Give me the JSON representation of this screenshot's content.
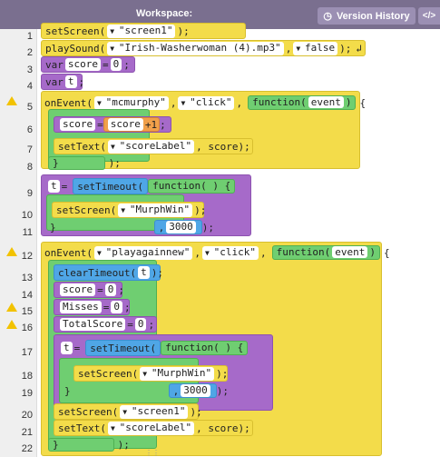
{
  "header": {
    "title": "Workspace:",
    "version_history": "Version History",
    "code_toggle": "</>"
  },
  "line_numbers": [
    "1",
    "2",
    "3",
    "4",
    "5",
    "6",
    "7",
    "8",
    "9",
    "10",
    "11",
    "12",
    "13",
    "14",
    "15",
    "16",
    "17",
    "18",
    "19",
    "20",
    "21",
    "22"
  ],
  "warnings_on_lines": [
    5,
    12,
    15,
    16
  ],
  "code": {
    "l1": {
      "fn": "setScreen(",
      "arg": "\"screen1\"",
      "end": ");"
    },
    "l2": {
      "fn": "playSound(",
      "arg1": "\"Irish-Washerwoman (4).mp3\"",
      "comma": ",",
      "arg2": "false",
      "end": ");"
    },
    "l3": {
      "kw": "var",
      "name": "score",
      "eq": "=",
      "val": "0",
      "end": ";"
    },
    "l4": {
      "kw": "var",
      "name": "t",
      "end": ";"
    },
    "l5": {
      "fn": "onEvent(",
      "arg1": "\"mcmurphy\"",
      "comma": ",",
      "arg2": "\"click\"",
      "comma2": ",",
      "func": "function(",
      "param": "event",
      "close": ")",
      "brace": "{"
    },
    "l6": {
      "lhs": "score",
      "eq": "=",
      "rhs": "score",
      "op": "+",
      "num": "1",
      "end": ";"
    },
    "l7": {
      "fn": "setText(",
      "arg1": "\"scoreLabel\"",
      "rest": ", score);"
    },
    "l8": {
      "text": "}",
      "end": ");"
    },
    "l9": {
      "lhs": "t",
      "eq": "=",
      "fn": "setTimeout",
      "paren": "(",
      "func": "function( ) {"
    },
    "l10": {
      "fn": "setScreen(",
      "arg": "\"MurphWin\"",
      "end": ");"
    },
    "l11": {
      "brace": "}",
      "num": "3000",
      "end": ");"
    },
    "l12": {
      "fn": "onEvent(",
      "arg1": "\"playagainnew\"",
      "comma": ",",
      "arg2": "\"click\"",
      "comma2": ",",
      "func": "function(",
      "param": "event",
      "close": ")",
      "brace": "{"
    },
    "l13": {
      "fn": "clearTimeout(",
      "arg": "t",
      "end": ");"
    },
    "l14": {
      "lhs": "score",
      "eq": "=",
      "val": "0",
      "end": ";"
    },
    "l15": {
      "lhs": "Misses",
      "eq": "=",
      "val": "0",
      "end": ";"
    },
    "l16": {
      "lhs": "TotalScore",
      "eq": "=",
      "val": "0",
      "end": ";"
    },
    "l17": {
      "lhs": "t",
      "eq": "=",
      "fn": "setTimeout",
      "paren": "(",
      "func": "function( ) {"
    },
    "l18": {
      "fn": "setScreen(",
      "arg": "\"MurphWin\"",
      "end": ");"
    },
    "l19": {
      "brace": "}",
      "num": "3000",
      "end": ");"
    },
    "l20": {
      "fn": "setScreen(",
      "arg": "\"screen1\"",
      "end": ");"
    },
    "l21": {
      "fn": "setText(",
      "arg1": "\"scoreLabel\"",
      "rest": ", score);"
    },
    "l22": {
      "text": "}",
      "end": ");"
    }
  },
  "colors": {
    "header": "#7a6f8f",
    "yellow": "#f3dc4a",
    "purple": "#a66ac9",
    "green": "#6fce71",
    "blue": "#4fa6e6",
    "orange": "#f1a04a",
    "warning": "#f2c200"
  }
}
